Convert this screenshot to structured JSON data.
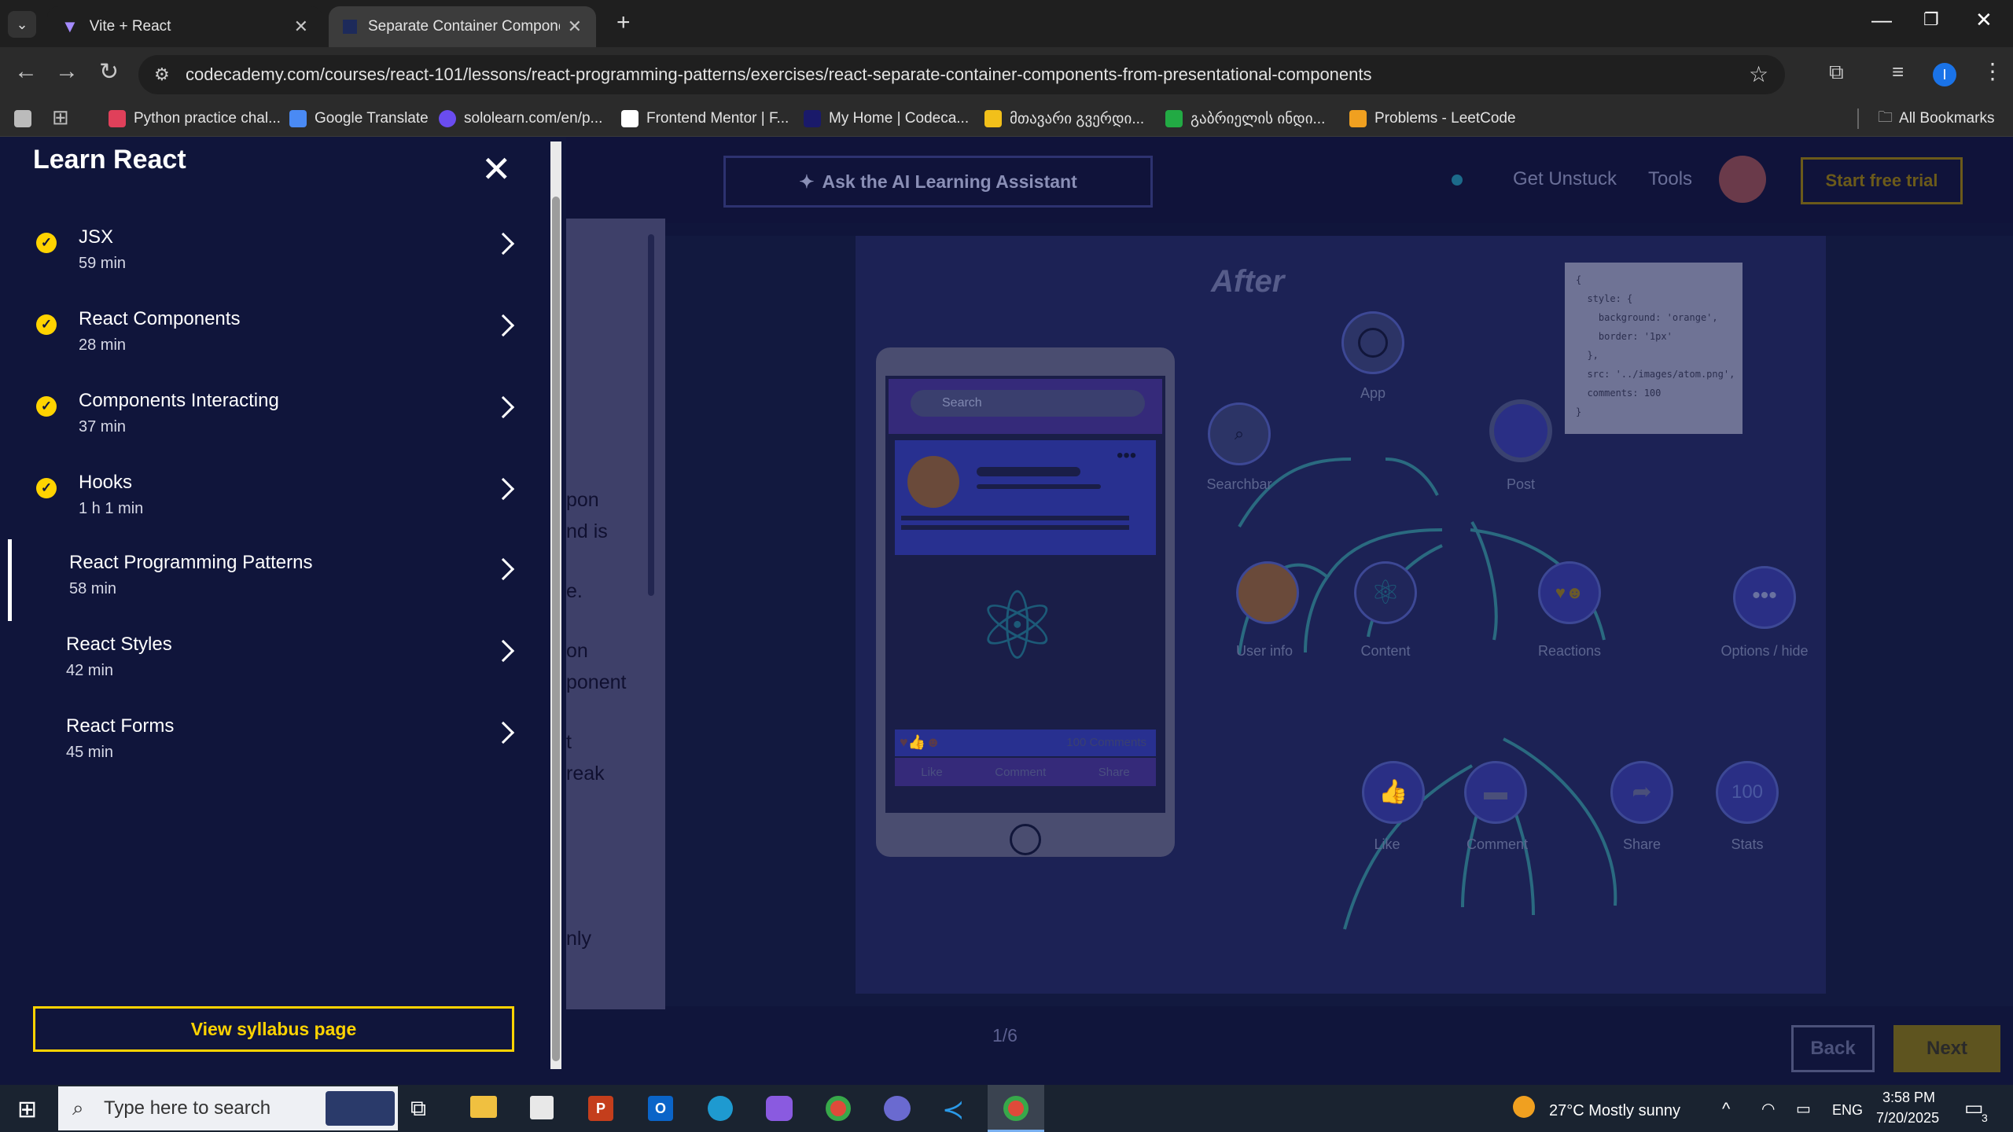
{
  "browser": {
    "tabs": [
      {
        "title": "Vite + React",
        "active": false
      },
      {
        "title": "Separate Container Component",
        "active": true
      }
    ],
    "new_tab_icon": "plus-icon",
    "url": "codecademy.com/courses/react-101/lessons/react-programming-patterns/exercises/react-separate-container-components-from-presentational-components",
    "bookmarks": [
      {
        "label": "Python practice chal...",
        "color": "#e0405a"
      },
      {
        "label": "Google Translate",
        "color": "#4a8af4"
      },
      {
        "label": "sololearn.com/en/p...",
        "color": "#6a4cf0"
      },
      {
        "label": "Frontend Mentor | F...",
        "color": "#ffffff"
      },
      {
        "label": "My Home | Codeca...",
        "color": "#1a1a6a"
      },
      {
        "label": "მთავარი გვერდი...",
        "color": "#f2c01a"
      },
      {
        "label": "გაბრიელის ინდი...",
        "color": "#22aa44"
      },
      {
        "label": "Problems - LeetCode",
        "color": "#f0a020"
      }
    ],
    "all_bookmarks": "All Bookmarks"
  },
  "topnav": {
    "ai_button": "Ask the AI Learning Assistant",
    "get_unstuck": "Get Unstuck",
    "tools": "Tools",
    "trial": "Start free trial"
  },
  "sidebar": {
    "title": "Learn React",
    "items": [
      {
        "title": "JSX",
        "duration": "59 min",
        "done": true
      },
      {
        "title": "React Components",
        "duration": "28 min",
        "done": true
      },
      {
        "title": "Components Interacting",
        "duration": "37 min",
        "done": true
      },
      {
        "title": "Hooks",
        "duration": "1 h 1 min",
        "done": true
      },
      {
        "title": "React Programming Patterns",
        "duration": "58 min",
        "done": false,
        "active": true
      },
      {
        "title": "React Styles",
        "duration": "42 min",
        "done": false
      },
      {
        "title": "React Forms",
        "duration": "45 min",
        "done": false
      }
    ],
    "syllabus_button": "View syllabus page"
  },
  "lesson_fragments": [
    "pon",
    "nd is",
    "e.",
    "on",
    "ponent",
    "t",
    "reak",
    "nly"
  ],
  "figure": {
    "heading": "After",
    "code": "{\n  style: {\n    background: 'orange',\n    border: '1px'\n  },\n  src: '../images/atom.png',\n  comments: 100\n}",
    "phone_search": "Search",
    "phone_comments": "100 Comments",
    "phone_actions": [
      "Like",
      "Comment",
      "Share"
    ],
    "nodes": {
      "app": "App",
      "searchbar": "Searchbar",
      "post": "Post",
      "userinfo": "User info",
      "content": "Content",
      "reactions": "Reactions",
      "options": "Options / hide",
      "like": "Like",
      "comment": "Comment",
      "share": "Share",
      "stats": "Stats",
      "stats_value": "100"
    }
  },
  "footer": {
    "pager": "1/6",
    "back": "Back",
    "next": "Next"
  },
  "taskbar": {
    "search_placeholder": "Type here to search",
    "weather": "27°C  Mostly sunny",
    "lang": "ENG",
    "time": "3:58 PM",
    "date": "7/20/2025",
    "notifications": "3"
  }
}
